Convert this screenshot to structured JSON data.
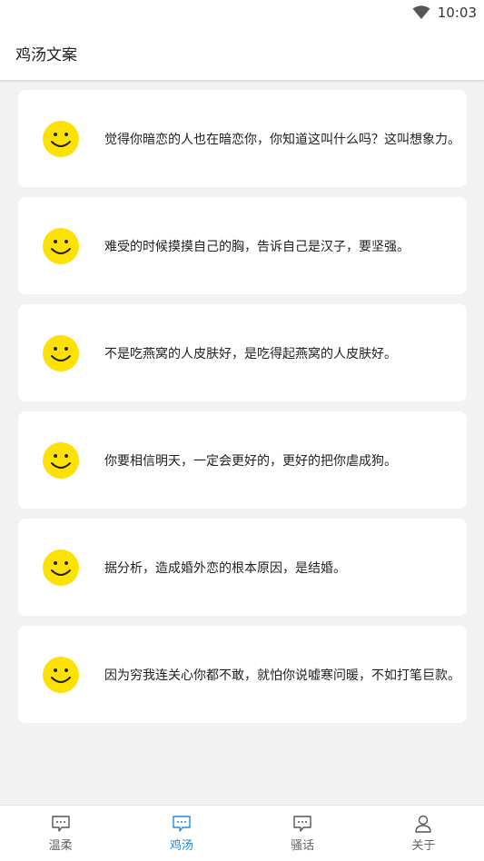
{
  "status_bar": {
    "time": "10:03",
    "wifi_icon": "wifi-icon"
  },
  "header": {
    "title": "鸡汤文案"
  },
  "cards": [
    {
      "icon": "smiley-icon",
      "text": "觉得你暗恋的人也在暗恋你，你知道这叫什么吗？这叫想象力。"
    },
    {
      "icon": "smiley-icon",
      "text": "难受的时候摸摸自己的胸，告诉自己是汉子，要坚强。"
    },
    {
      "icon": "smiley-icon",
      "text": "不是吃燕窝的人皮肤好，是吃得起燕窝的人皮肤好。"
    },
    {
      "icon": "smiley-icon",
      "text": "你要相信明天，一定会更好的，更好的把你虐成狗。"
    },
    {
      "icon": "smiley-icon",
      "text": "据分析，造成婚外恋的根本原因，是结婚。"
    },
    {
      "icon": "smiley-icon",
      "text": "因为穷我连关心你都不敢，就怕你说嘘寒问暖，不如打笔巨款。"
    }
  ],
  "tabs": [
    {
      "label": "温柔",
      "icon": "chat-bubble-icon",
      "active": false
    },
    {
      "label": "鸡汤",
      "icon": "chat-bubble-icon",
      "active": true
    },
    {
      "label": "骚话",
      "icon": "chat-bubble-icon",
      "active": false
    },
    {
      "label": "关于",
      "icon": "person-icon",
      "active": false
    }
  ],
  "colors": {
    "accent": "#1e88e5",
    "smiley_yellow": "#fde100",
    "background": "#f2f2f2",
    "inactive_tab": "#666666"
  }
}
